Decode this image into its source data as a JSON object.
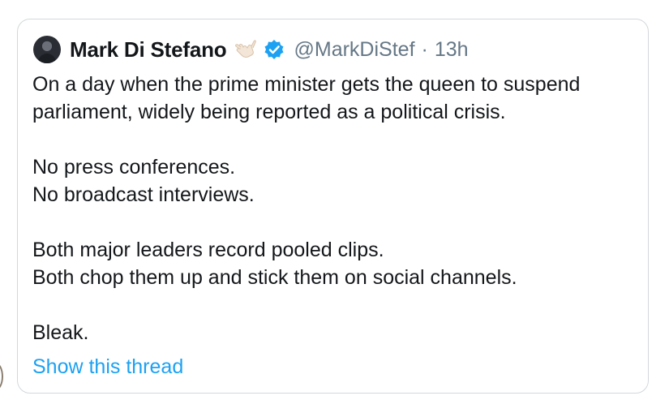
{
  "tweet": {
    "author": {
      "display_name": "Mark Di Stefano",
      "handle": "@MarkDiStef",
      "emoji_icon": "call-me-hand-icon",
      "verified_icon": "verified-badge-icon"
    },
    "separator": "·",
    "timestamp": "13h",
    "body": {
      "paragraphs": [
        {
          "lines": [
            "On a day when the prime minister gets the queen to suspend",
            "parliament, widely being reported as a political crisis."
          ]
        },
        {
          "lines": [
            "No press conferences.",
            "No broadcast interviews."
          ]
        },
        {
          "lines": [
            "Both major leaders record pooled clips.",
            "Both chop them up and stick them on social channels."
          ]
        },
        {
          "lines": [
            "Bleak."
          ]
        }
      ]
    },
    "show_thread_label": "Show this thread"
  },
  "colors": {
    "text": "#14171a",
    "secondary": "#657786",
    "link": "#1da1f2",
    "verified": "#1da1f2",
    "border": "#d3d8dc"
  }
}
